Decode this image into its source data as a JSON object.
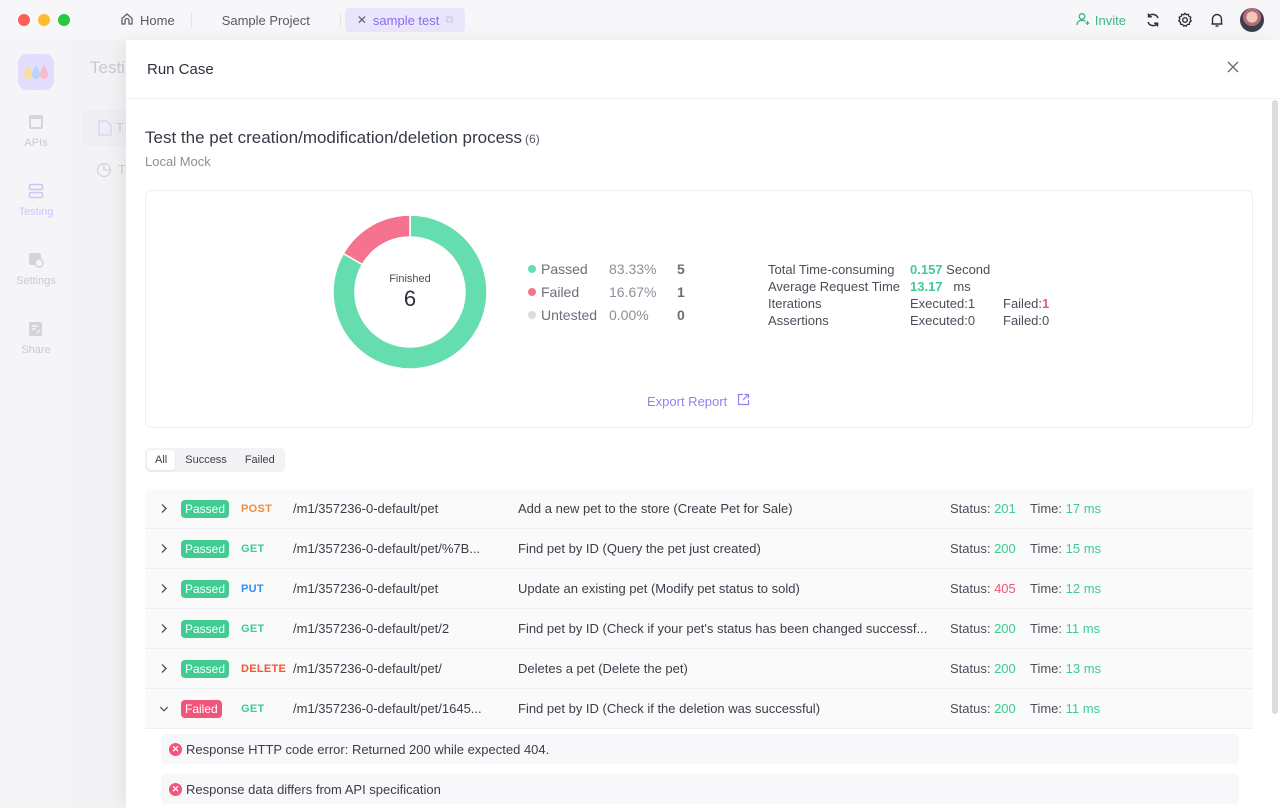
{
  "titlebar": {
    "tabs": [
      {
        "label": "Home",
        "icon": "home-icon"
      },
      {
        "label": "Sample Project"
      },
      {
        "label": "sample test",
        "active": true
      }
    ],
    "invite_label": "Invite"
  },
  "rail": {
    "items": [
      {
        "label": "APIs",
        "icon": "api-icon"
      },
      {
        "label": "Testing",
        "icon": "testing-icon",
        "active": true
      },
      {
        "label": "Settings",
        "icon": "settings-icon"
      },
      {
        "label": "Share",
        "icon": "share-icon"
      }
    ],
    "subnav_title": "Testi",
    "subnav_items": [
      "T",
      "T"
    ]
  },
  "drawer": {
    "title": "Run Case"
  },
  "case": {
    "title": "Test the pet creation/modification/deletion process",
    "count": "(6)",
    "environment": "Local Mock"
  },
  "colors": {
    "passed": "#66ddaf",
    "failed": "#f6738f",
    "untested": "#dcdcdf",
    "accent": "#9b7ef3"
  },
  "chart_data": {
    "type": "pie",
    "center_label": "Finished",
    "center_value": "6",
    "slices": [
      {
        "name": "Passed",
        "percent": "83.33%",
        "count": 5,
        "value": 5
      },
      {
        "name": "Failed",
        "percent": "16.67%",
        "count": 1,
        "value": 1
      },
      {
        "name": "Untested",
        "percent": "0.00%",
        "count": 0,
        "value": 0
      }
    ]
  },
  "stats": {
    "total_time_label": "Total Time-consuming",
    "total_time_value": "0.157",
    "total_time_unit": "Second",
    "avg_time_label": "Average Request Time",
    "avg_time_value": "13.17",
    "avg_time_unit": "ms",
    "iterations_label": "Iterations",
    "iterations_executed": "Executed:1",
    "iterations_failed_label": "Failed:",
    "iterations_failed_value": "1",
    "assertions_label": "Assertions",
    "assertions_executed": "Executed:0",
    "assertions_failed": "Failed:0"
  },
  "export_label": "Export Report",
  "filters": [
    {
      "label": "All",
      "active": true
    },
    {
      "label": "Success"
    },
    {
      "label": "Failed"
    }
  ],
  "status_label": "Status: ",
  "time_label": "Time: ",
  "rows": [
    {
      "result": "Passed",
      "method": "POST",
      "method_color": "#f08c3a",
      "path": "/m1/357236-0-default/pet",
      "desc": "Add a new pet to the store (Create Pet for Sale)",
      "status": "201",
      "status_ok": true,
      "time": "17 ms",
      "expanded": false
    },
    {
      "result": "Passed",
      "method": "GET",
      "method_color": "#3ecc92",
      "path": "/m1/357236-0-default/pet/%7B...",
      "desc": "Find pet by ID (Query the pet just created)",
      "status": "200",
      "status_ok": true,
      "time": "15 ms",
      "expanded": false
    },
    {
      "result": "Passed",
      "method": "PUT",
      "method_color": "#2f8ef5",
      "path": "/m1/357236-0-default/pet",
      "desc": "Update an existing pet (Modify pet status to sold)",
      "status": "405",
      "status_ok": false,
      "time": "12 ms",
      "expanded": false
    },
    {
      "result": "Passed",
      "method": "GET",
      "method_color": "#3ecc92",
      "path": "/m1/357236-0-default/pet/2",
      "desc": "Find pet by ID (Check if your pet's status has been changed successf...",
      "status": "200",
      "status_ok": true,
      "time": "11 ms",
      "expanded": false
    },
    {
      "result": "Passed",
      "method": "DELETE",
      "method_color": "#f2572f",
      "path": "/m1/357236-0-default/pet/",
      "desc": "Deletes a pet (Delete the pet)",
      "status": "200",
      "status_ok": true,
      "time": "13 ms",
      "expanded": false
    },
    {
      "result": "Failed",
      "method": "GET",
      "method_color": "#3ecc92",
      "path": "/m1/357236-0-default/pet/1645...",
      "desc": "Find pet by ID (Check if the deletion was successful)",
      "status": "200",
      "status_ok": true,
      "time": "11 ms",
      "expanded": true
    }
  ],
  "errors": [
    "Response HTTP code error: Returned 200 while expected 404.",
    "Response data differs from API specification"
  ]
}
